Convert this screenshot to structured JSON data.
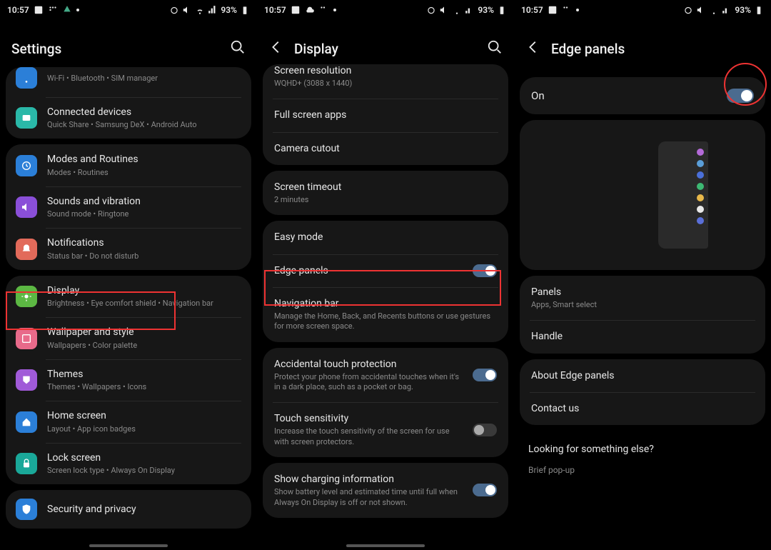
{
  "status": {
    "time": "10:57",
    "battery": "93%"
  },
  "screen1": {
    "header": {
      "title": "Settings"
    },
    "items": [
      {
        "title": "",
        "sub": "Wi-Fi  •  Bluetooth  •  SIM manager",
        "icon": "wifi",
        "color": "bg-blue",
        "cut": true
      },
      {
        "title": "Connected devices",
        "sub": "Quick Share  •  Samsung DeX  •  Android Auto",
        "icon": "devices",
        "color": "bg-teal"
      }
    ],
    "items2": [
      {
        "title": "Modes and Routines",
        "sub": "Modes  •  Routines",
        "icon": "routines",
        "color": "bg-blue"
      },
      {
        "title": "Sounds and vibration",
        "sub": "Sound mode  •  Ringtone",
        "icon": "sound",
        "color": "bg-purple"
      },
      {
        "title": "Notifications",
        "sub": "Status bar  •  Do not disturb",
        "icon": "bell",
        "color": "bg-coral"
      }
    ],
    "items3": [
      {
        "title": "Display",
        "sub": "Brightness  •  Eye comfort shield  •  Navigation bar",
        "icon": "display",
        "color": "bg-green"
      },
      {
        "title": "Wallpaper and style",
        "sub": "Wallpapers  •  Color palette",
        "icon": "wallpaper",
        "color": "bg-pink"
      },
      {
        "title": "Themes",
        "sub": "Themes  •  Wallpapers  •  Icons",
        "icon": "themes",
        "color": "bg-purple2"
      },
      {
        "title": "Home screen",
        "sub": "Layout  •  App icon badges",
        "icon": "home",
        "color": "bg-blue"
      },
      {
        "title": "Lock screen",
        "sub": "Screen lock type  •  Always On Display",
        "icon": "lock",
        "color": "bg-teal2"
      }
    ],
    "items4": [
      {
        "title": "Security and privacy",
        "sub": "",
        "icon": "shield",
        "color": "bg-blue"
      }
    ]
  },
  "screen2": {
    "header": {
      "title": "Display"
    },
    "group1": [
      {
        "title": "Screen resolution",
        "sub": "WQHD+ (3088 x 1440)"
      },
      {
        "title": "Full screen apps",
        "sub": ""
      },
      {
        "title": "Camera cutout",
        "sub": ""
      }
    ],
    "group2": [
      {
        "title": "Screen timeout",
        "sub": "2 minutes"
      }
    ],
    "group3": [
      {
        "title": "Easy mode",
        "sub": ""
      },
      {
        "title": "Edge panels",
        "sub": "",
        "toggle": true
      },
      {
        "title": "Navigation bar",
        "sub": "Manage the Home, Back, and Recents buttons or use gestures for more screen space."
      }
    ],
    "group4": [
      {
        "title": "Accidental touch protection",
        "sub": "Protect your phone from accidental touches when it's in a dark place, such as a pocket or bag.",
        "toggle": true
      },
      {
        "title": "Touch sensitivity",
        "sub": "Increase the touch sensitivity of the screen for use with screen protectors.",
        "toggle": false
      }
    ],
    "group5": [
      {
        "title": "Show charging information",
        "sub": "Show battery level and estimated time until full when Always On Display is off or not shown.",
        "toggle": true
      }
    ]
  },
  "screen3": {
    "header": {
      "title": "Edge panels"
    },
    "on_label": "On",
    "preview_colors": [
      "#b46ad8",
      "#5a9ed8",
      "#4a6fd8",
      "#3db873",
      "#e8b84a",
      "#e8e8e8",
      "#5a6fd8"
    ],
    "group1": [
      {
        "title": "Panels",
        "sub": "Apps, Smart select"
      },
      {
        "title": "Handle",
        "sub": ""
      }
    ],
    "group2": [
      {
        "title": "About Edge panels",
        "sub": ""
      },
      {
        "title": "Contact us",
        "sub": ""
      }
    ],
    "looking": {
      "label": "Looking for something else?",
      "link": "Brief pop-up"
    }
  }
}
